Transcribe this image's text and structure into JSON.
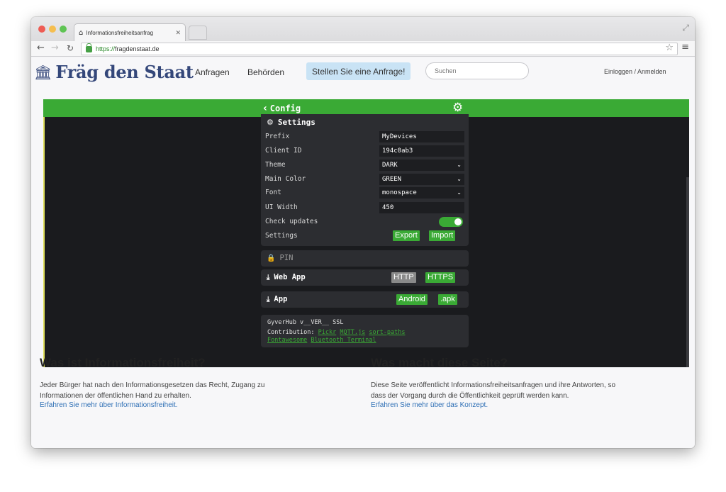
{
  "browser": {
    "tab_title": "Informationsfreiheitsanfrag",
    "tab_favicon": "home-icon",
    "url_scheme": "https://",
    "url_host": "fragdenstaat.de"
  },
  "site": {
    "logo_text": "Fräg den Staat",
    "nav": {
      "requests": "Anfragen",
      "authorities": "Behörden"
    },
    "cta": "Stellen Sie eine Anfrage!",
    "search_placeholder": "Suchen",
    "login": "Einloggen / Anmelden"
  },
  "app": {
    "header_title": "Config",
    "accent": "#3aaa35",
    "settings": {
      "title": "Settings",
      "rows": [
        {
          "label": "Prefix",
          "value": "MyDevices"
        },
        {
          "label": "Client ID",
          "value": "194c0ab3"
        },
        {
          "label": "Theme",
          "value": "DARK"
        },
        {
          "label": "Main Color",
          "value": "GREEN"
        },
        {
          "label": "Font",
          "value": "monospace"
        },
        {
          "label": "UI Width",
          "value": "450"
        },
        {
          "label": "Check updates",
          "value": true
        },
        {
          "label": "Settings"
        }
      ],
      "export_label": "Export",
      "import_label": "Import"
    },
    "pin_label": "PIN",
    "webapp": {
      "label": "Web App",
      "http": "HTTP",
      "https": "HTTPS"
    },
    "mobile_app": {
      "label": "App",
      "android": "Android",
      "apk": ".apk"
    },
    "info": {
      "version": "GyverHub v__VER__ SSL",
      "contribution_label": "Contribution:",
      "links": [
        "Pickr",
        "MQTT.js",
        "sort-paths",
        "Fontawesome",
        "Bluetooth Terminal"
      ]
    }
  },
  "sections": {
    "left": {
      "title": "Was ist Informationsfreiheit?",
      "line1": "Jeder Bürger hat nach den Informationsgesetzen das Recht, Zugang zu",
      "line2": "Informationen der öffentlichen Hand zu erhalten.",
      "link": "Erfahren Sie mehr über Informationsfreiheit."
    },
    "right": {
      "title": "Was macht diese Seite?",
      "line1": "Diese Seite veröffentlicht Informationsfreiheitsanfragen und ihre Antworten, so",
      "line2": "dass der Vorgang durch die Öffentlichkeit geprüft werden kann.",
      "link": "Erfahren Sie mehr über das Konzept."
    }
  }
}
